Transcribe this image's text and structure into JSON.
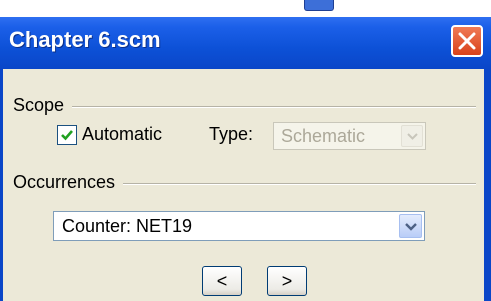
{
  "window": {
    "title": "Chapter 6.scm"
  },
  "scope": {
    "label": "Scope",
    "automatic_label": "Automatic",
    "automatic_checked": true,
    "type_label": "Type:",
    "type_value": "Schematic"
  },
  "occurrences": {
    "label": "Occurrences",
    "selected": "Counter: NET19"
  },
  "nav": {
    "prev_label": "<",
    "next_label": ">"
  },
  "colors": {
    "titlebar": "#0a46c8",
    "close": "#d9421b",
    "check": "#21a121"
  },
  "icons": {
    "close": "close-icon",
    "dropdown": "chevron-down-icon",
    "check": "checkmark-icon"
  }
}
